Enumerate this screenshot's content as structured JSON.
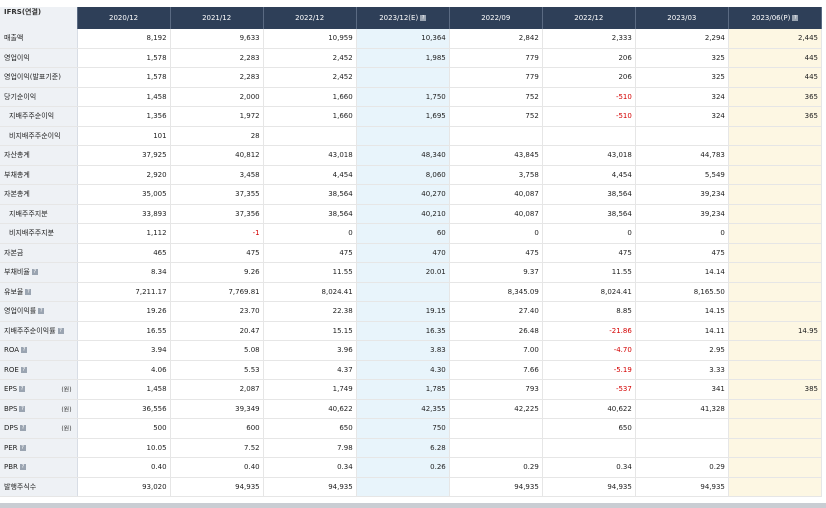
{
  "header": {
    "corner": "IFRS(연결)",
    "columns": [
      "2020/12",
      "2021/12",
      "2022/12",
      "2023/12(E)",
      "2022/09",
      "2022/12",
      "2023/03",
      "2023/06(P)"
    ]
  },
  "rows": [
    {
      "label": "매출액",
      "sub": false,
      "icon": false,
      "unit": "",
      "values": [
        "8,192",
        "9,633",
        "10,959",
        "10,364",
        "2,842",
        "2,333",
        "2,294",
        "2,445"
      ]
    },
    {
      "label": "영업이익",
      "sub": false,
      "icon": false,
      "unit": "",
      "values": [
        "1,578",
        "2,283",
        "2,452",
        "1,985",
        "779",
        "206",
        "325",
        "445"
      ]
    },
    {
      "label": "영업이익(발표기준)",
      "sub": false,
      "icon": false,
      "unit": "",
      "values": [
        "1,578",
        "2,283",
        "2,452",
        "",
        "779",
        "206",
        "325",
        "445"
      ]
    },
    {
      "label": "당기순이익",
      "sub": false,
      "icon": false,
      "unit": "",
      "values": [
        "1,458",
        "2,000",
        "1,660",
        "1,750",
        "752",
        "-510",
        "324",
        "365"
      ]
    },
    {
      "label": "지배주주순이익",
      "sub": true,
      "icon": false,
      "unit": "",
      "values": [
        "1,356",
        "1,972",
        "1,660",
        "1,695",
        "752",
        "-510",
        "324",
        "365"
      ]
    },
    {
      "label": "비지배주주순이익",
      "sub": true,
      "icon": false,
      "unit": "",
      "values": [
        "101",
        "28",
        "",
        "",
        "",
        "",
        "",
        ""
      ]
    },
    {
      "label": "자산총계",
      "sub": false,
      "icon": false,
      "unit": "",
      "values": [
        "37,925",
        "40,812",
        "43,018",
        "48,340",
        "43,845",
        "43,018",
        "44,783",
        ""
      ]
    },
    {
      "label": "부채총계",
      "sub": false,
      "icon": false,
      "unit": "",
      "values": [
        "2,920",
        "3,458",
        "4,454",
        "8,060",
        "3,758",
        "4,454",
        "5,549",
        ""
      ]
    },
    {
      "label": "자본총계",
      "sub": false,
      "icon": false,
      "unit": "",
      "values": [
        "35,005",
        "37,355",
        "38,564",
        "40,270",
        "40,087",
        "38,564",
        "39,234",
        ""
      ]
    },
    {
      "label": "지배주주지분",
      "sub": true,
      "icon": false,
      "unit": "",
      "values": [
        "33,893",
        "37,356",
        "38,564",
        "40,210",
        "40,087",
        "38,564",
        "39,234",
        ""
      ]
    },
    {
      "label": "비지배주주지분",
      "sub": true,
      "icon": false,
      "unit": "",
      "values": [
        "1,112",
        "-1",
        "0",
        "60",
        "0",
        "0",
        "0",
        ""
      ]
    },
    {
      "label": "자본금",
      "sub": false,
      "icon": false,
      "unit": "",
      "values": [
        "465",
        "475",
        "475",
        "470",
        "475",
        "475",
        "475",
        ""
      ]
    },
    {
      "label": "부채비율",
      "sub": false,
      "icon": true,
      "unit": "",
      "values": [
        "8.34",
        "9.26",
        "11.55",
        "20.01",
        "9.37",
        "11.55",
        "14.14",
        ""
      ]
    },
    {
      "label": "유보율",
      "sub": false,
      "icon": true,
      "unit": "",
      "values": [
        "7,211.17",
        "7,769.81",
        "8,024.41",
        "",
        "8,345.09",
        "8,024.41",
        "8,165.50",
        ""
      ]
    },
    {
      "label": "영업이익률",
      "sub": false,
      "icon": true,
      "unit": "",
      "values": [
        "19.26",
        "23.70",
        "22.38",
        "19.15",
        "27.40",
        "8.85",
        "14.15",
        ""
      ]
    },
    {
      "label": "지배주주순이익률",
      "sub": false,
      "icon": true,
      "unit": "",
      "values": [
        "16.55",
        "20.47",
        "15.15",
        "16.35",
        "26.48",
        "-21.86",
        "14.11",
        "14.95"
      ]
    },
    {
      "label": "ROA",
      "sub": false,
      "icon": true,
      "unit": "",
      "values": [
        "3.94",
        "5.08",
        "3.96",
        "3.83",
        "7.00",
        "-4.70",
        "2.95",
        ""
      ]
    },
    {
      "label": "ROE",
      "sub": false,
      "icon": true,
      "unit": "",
      "values": [
        "4.06",
        "5.53",
        "4.37",
        "4.30",
        "7.66",
        "-5.19",
        "3.33",
        ""
      ]
    },
    {
      "label": "EPS",
      "sub": false,
      "icon": true,
      "unit": "(원)",
      "values": [
        "1,458",
        "2,087",
        "1,749",
        "1,785",
        "793",
        "-537",
        "341",
        "385"
      ]
    },
    {
      "label": "BPS",
      "sub": false,
      "icon": true,
      "unit": "(원)",
      "values": [
        "36,556",
        "39,349",
        "40,622",
        "42,355",
        "42,225",
        "40,622",
        "41,328",
        ""
      ]
    },
    {
      "label": "DPS",
      "sub": false,
      "icon": true,
      "unit": "(원)",
      "values": [
        "500",
        "600",
        "650",
        "750",
        "",
        "650",
        "",
        ""
      ]
    },
    {
      "label": "PER",
      "sub": false,
      "icon": true,
      "unit": "",
      "values": [
        "10.05",
        "7.52",
        "7.98",
        "6.28",
        "",
        "",
        "",
        ""
      ]
    },
    {
      "label": "PBR",
      "sub": false,
      "icon": true,
      "unit": "",
      "values": [
        "0.40",
        "0.40",
        "0.34",
        "0.26",
        "0.29",
        "0.34",
        "0.29",
        ""
      ]
    },
    {
      "label": "발행주식수",
      "sub": false,
      "icon": false,
      "unit": "",
      "values": [
        "93,020",
        "94,935",
        "94,935",
        "",
        "94,935",
        "94,935",
        "94,935",
        ""
      ]
    }
  ],
  "colors": {
    "header_bg": "#2e3f58",
    "estimate_col_bg": "#e8f4fb",
    "preliminary_col_bg": "#fdf7e3",
    "negative": "#d40000"
  },
  "icons": {
    "info": "question-icon"
  }
}
